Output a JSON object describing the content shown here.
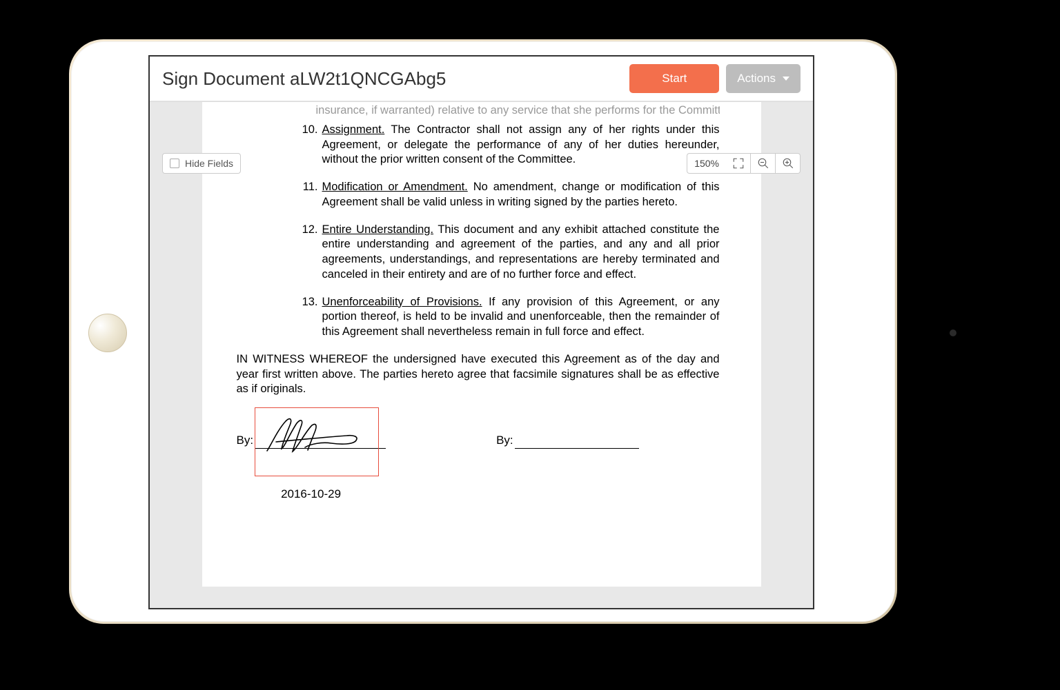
{
  "header": {
    "title": "Sign Document aLW2t1QNCGAbg5",
    "start": "Start",
    "actions": "Actions"
  },
  "toolbar": {
    "hide_fields": "Hide Fields",
    "zoom": "150%"
  },
  "doc": {
    "cutoff": "insurance, if warranted) relative to any service that she performs for the Committee.",
    "clauses": [
      {
        "n": "10.",
        "t": "Assignment.",
        "b": "  The Contractor shall not assign any of her rights under this Agreement, or delegate the performance of any of her duties hereunder, without the prior written consent of the Committee."
      },
      {
        "n": "11.",
        "t": "Modification or Amendment.",
        "b": "  No amendment, change or modification of this Agreement shall be valid unless in writing signed by the parties hereto."
      },
      {
        "n": "12.",
        "t": "Entire Understanding.",
        "b": "  This document and any exhibit attached constitute the entire understanding and agreement of the parties, and any and all prior agreements, understandings, and representations are hereby terminated and canceled in their entirety and are of no further force and effect."
      },
      {
        "n": "13.",
        "t": "Unenforceability of Provisions.",
        "b": "  If any provision of this Agreement, or any portion thereof, is held to be invalid and unenforceable, then the remainder of this Agreement shall nevertheless remain in full force and effect."
      }
    ],
    "witness": "IN WITNESS WHEREOF the undersigned have executed this Agreement as of the day and year first written above.  The parties hereto agree that facsimile signatures shall be as effective as if originals.",
    "by": "By:",
    "date": "2016-10-29"
  }
}
